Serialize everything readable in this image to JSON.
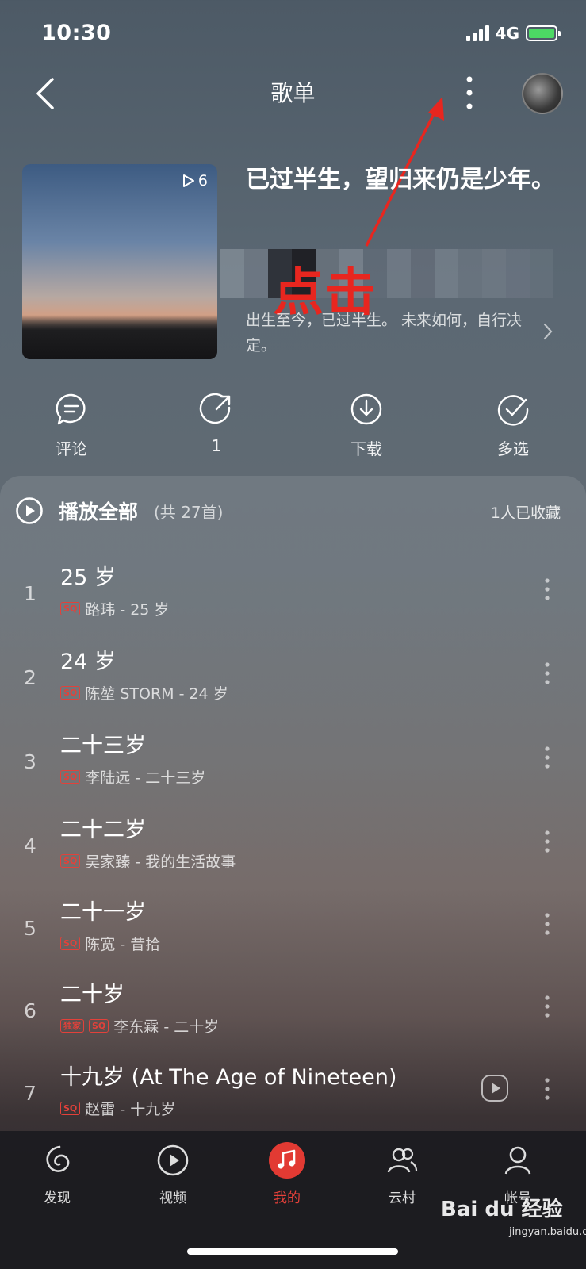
{
  "status_bar": {
    "time": "10:30",
    "network": "4G",
    "battery_color": "#4cd964"
  },
  "header": {
    "title": "歌单",
    "back_icon": "chevron-left-icon",
    "more_icon": "vertical-dots-icon"
  },
  "playlist": {
    "play_count": "6",
    "title": "已过半生，望归来仍是少年。",
    "description": "出生至今，已过半生。 未来如何，自行决定。"
  },
  "annotation": {
    "text": "点击",
    "color": "#e8261f"
  },
  "actions": [
    {
      "label": "评论",
      "icon": "comment-icon"
    },
    {
      "label": "1",
      "icon": "share-icon"
    },
    {
      "label": "下载",
      "icon": "download-icon"
    },
    {
      "label": "多选",
      "icon": "multi-select-icon"
    }
  ],
  "list_header": {
    "play_all": "播放全部",
    "count": "(共 27首)",
    "collected": "1人已收藏"
  },
  "songs": [
    {
      "index": "1",
      "title": "25 岁",
      "quality": "SQ",
      "meta": "路玮 - 25 岁"
    },
    {
      "index": "2",
      "title": "24 岁",
      "quality": "SQ",
      "meta": "陈堃 STORM - 24 岁"
    },
    {
      "index": "3",
      "title": "二十三岁",
      "quality": "SQ",
      "meta": "李陆远 - 二十三岁"
    },
    {
      "index": "4",
      "title": "二十二岁",
      "quality": "SQ",
      "meta": "吴家臻 - 我的生活故事"
    },
    {
      "index": "5",
      "title": "二十一岁",
      "quality": "SQ",
      "meta": "陈宽 - 昔拾"
    },
    {
      "index": "6",
      "title": "二十岁",
      "exclusive": "独家",
      "quality": "SQ",
      "meta": "李东霖 - 二十岁"
    },
    {
      "index": "7",
      "title": "十九岁 (At The Age of Nineteen)",
      "quality": "SQ",
      "meta": "赵雷 - 十九岁"
    }
  ],
  "tabs": [
    {
      "label": "发现",
      "icon": "discover-icon"
    },
    {
      "label": "视频",
      "icon": "video-icon"
    },
    {
      "label": "我的",
      "icon": "music-note-icon",
      "active": true
    },
    {
      "label": "云村",
      "icon": "community-icon"
    },
    {
      "label": "帐号",
      "icon": "account-icon"
    }
  ],
  "accent_color": "#e23a33",
  "watermark": {
    "brand": "Bai du 经验",
    "url": "jingyan.baidu.com"
  }
}
